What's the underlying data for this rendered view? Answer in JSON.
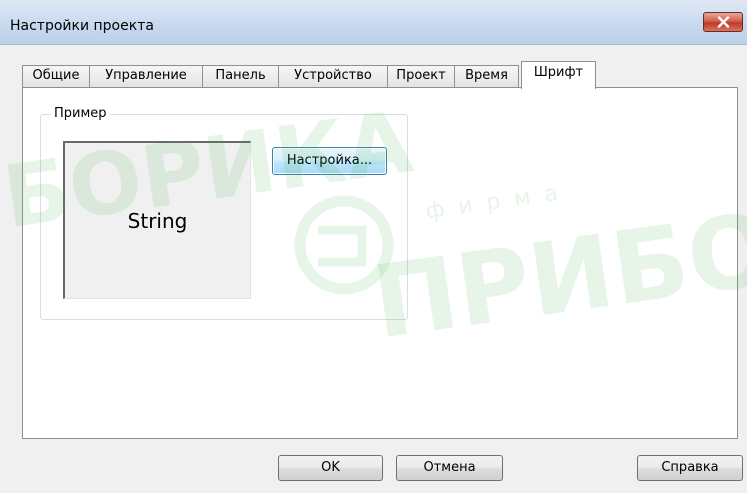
{
  "window": {
    "title": "Настройки проекта"
  },
  "tabs": [
    {
      "label": "Общие",
      "active": false
    },
    {
      "label": "Управление",
      "active": false
    },
    {
      "label": "Панель",
      "active": false
    },
    {
      "label": "Устройство",
      "active": false
    },
    {
      "label": "Проект",
      "active": false
    },
    {
      "label": "Время",
      "active": false
    },
    {
      "label": "Шрифт",
      "active": true
    }
  ],
  "font_tab": {
    "group_label": "Пример",
    "preview_text": "String",
    "settings_button": "Настройка..."
  },
  "footer": {
    "ok_label": "OK",
    "cancel_label": "Отмена",
    "help_label": "Справка"
  },
  "watermark": {
    "text_left": "БОРИКА",
    "text_small": "фирма",
    "text_right": "ПРИБО"
  },
  "colors": {
    "close_button": "#c0392b",
    "settings_button_border": "#3c7fb1",
    "watermark": "#3cb44b"
  }
}
